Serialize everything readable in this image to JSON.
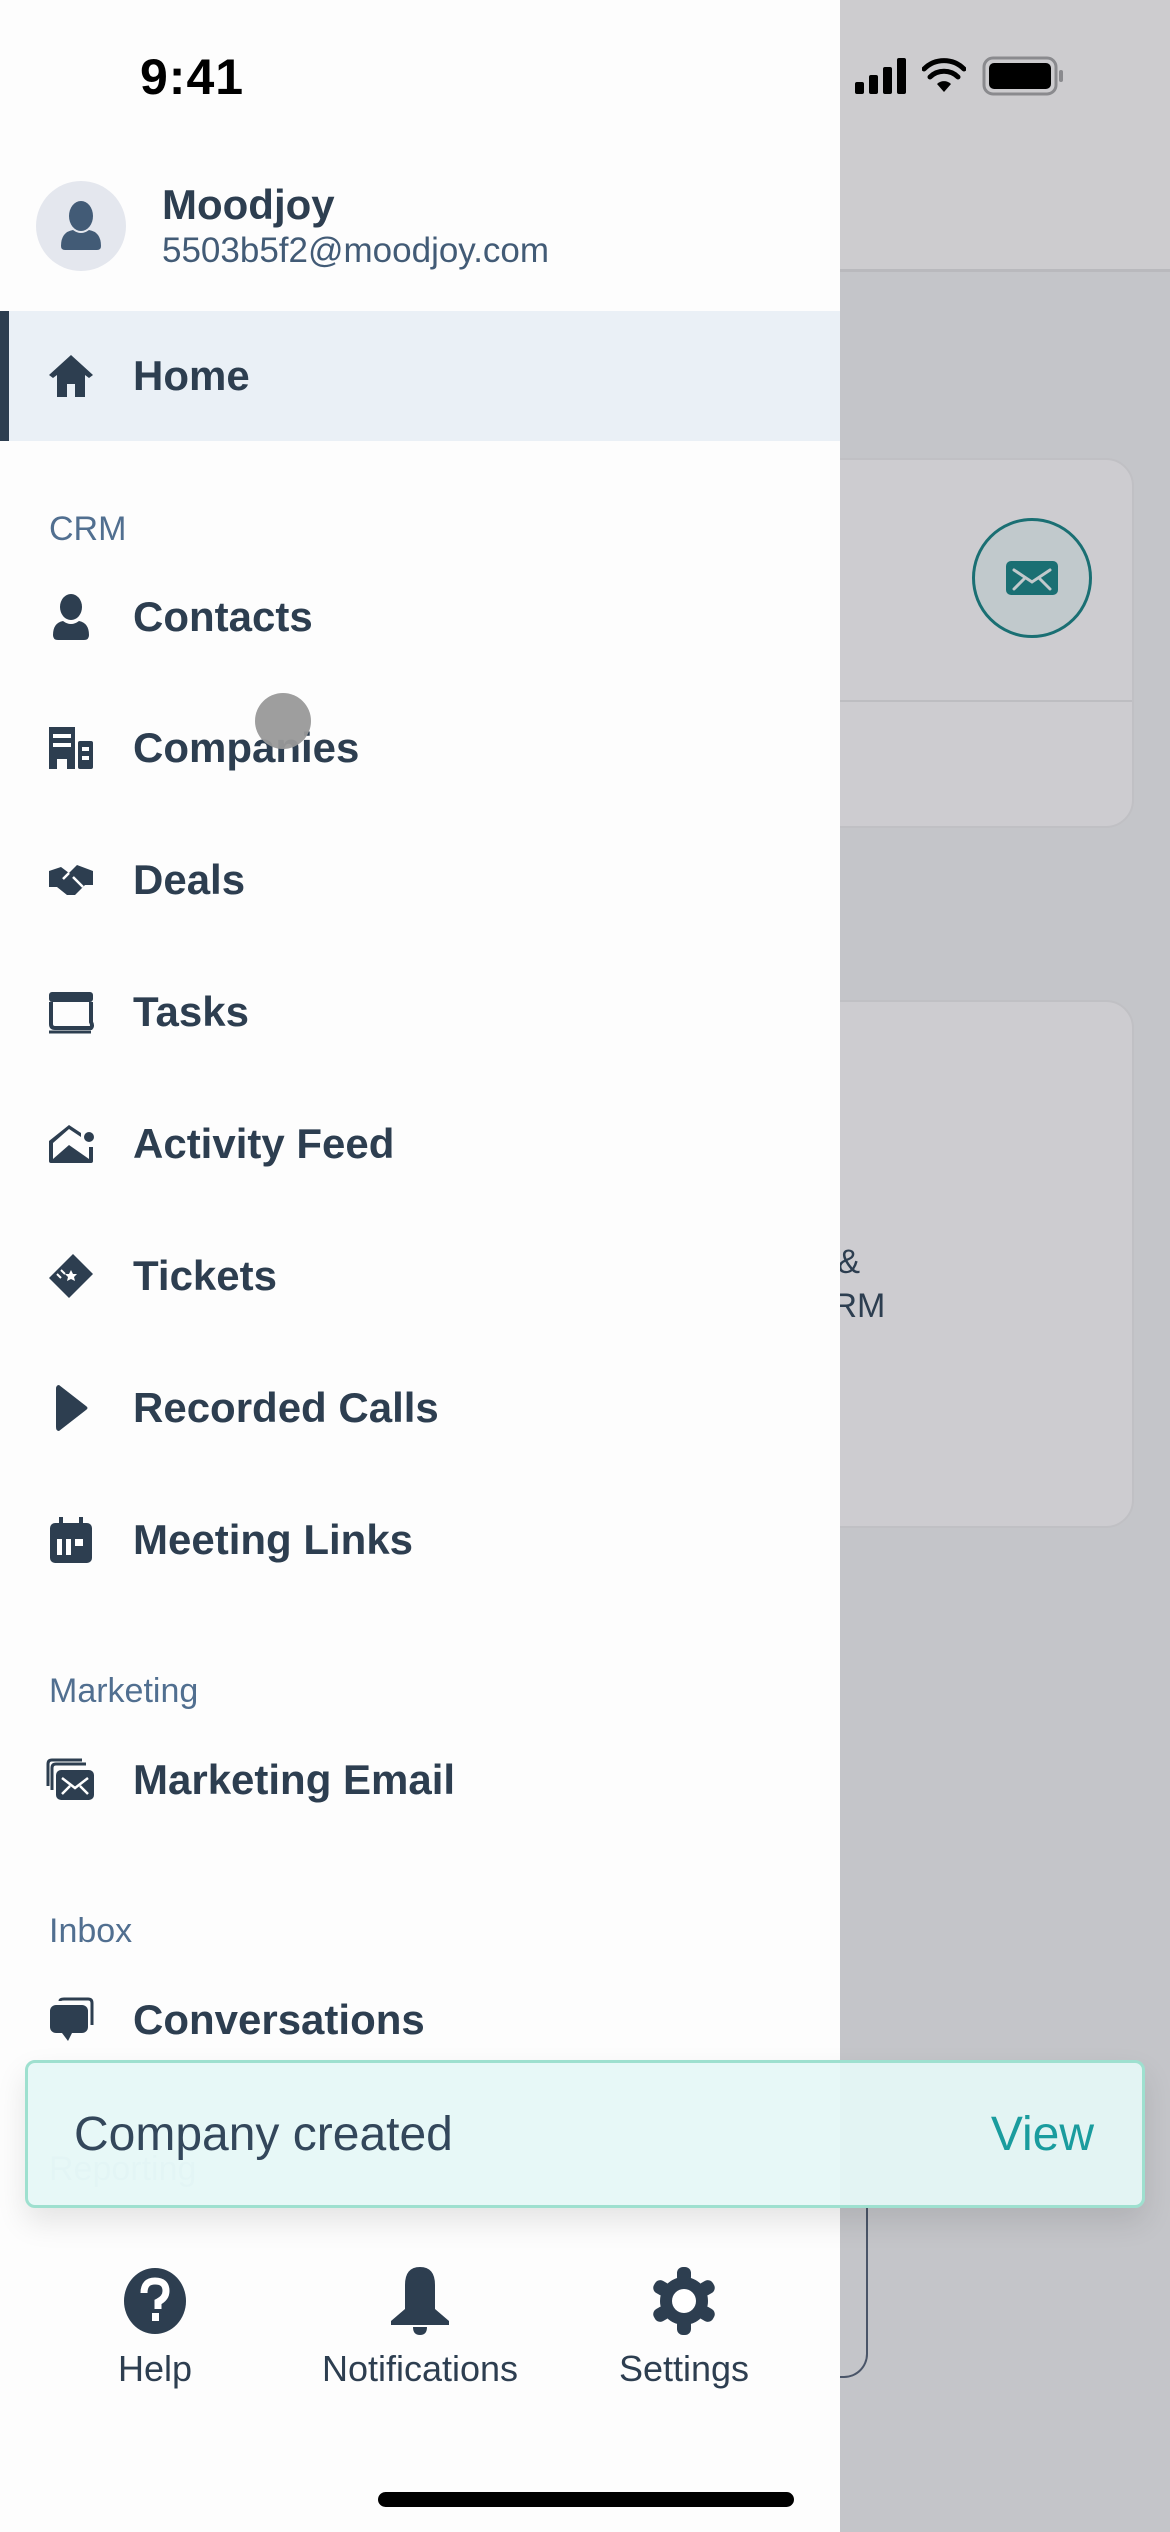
{
  "status_bar": {
    "time": "9:41"
  },
  "profile": {
    "name": "Moodjoy",
    "email": "5503b5f2@moodjoy.com",
    "avatar_icon": "user-silhouette-icon"
  },
  "drawer": {
    "home": {
      "label": "Home",
      "icon": "home-icon",
      "active": true
    },
    "sections": [
      {
        "title": "CRM",
        "items": [
          {
            "label": "Contacts",
            "icon": "contact-icon"
          },
          {
            "label": "Companies",
            "icon": "building-icon"
          },
          {
            "label": "Deals",
            "icon": "handshake-icon"
          },
          {
            "label": "Tasks",
            "icon": "tasks-icon"
          },
          {
            "label": "Activity Feed",
            "icon": "activity-feed-icon"
          },
          {
            "label": "Tickets",
            "icon": "ticket-icon"
          },
          {
            "label": "Recorded Calls",
            "icon": "play-icon"
          },
          {
            "label": "Meeting Links",
            "icon": "calendar-icon"
          }
        ]
      },
      {
        "title": "Marketing",
        "items": [
          {
            "label": "Marketing Email",
            "icon": "marketing-email-icon"
          }
        ]
      },
      {
        "title": "Inbox",
        "items": [
          {
            "label": "Conversations",
            "icon": "chat-bubble-icon"
          }
        ]
      },
      {
        "title": "Reporting",
        "items": []
      }
    ]
  },
  "toast": {
    "message": "Company created",
    "action": "View"
  },
  "bottom_bar": [
    {
      "label": "Help",
      "icon": "help-icon"
    },
    {
      "label": "Notifications",
      "icon": "bell-icon"
    },
    {
      "label": "Settings",
      "icon": "gear-icon"
    }
  ],
  "background": {
    "card_text": "gs &\n' CRM",
    "accent_color": "#1a6f73"
  },
  "colors": {
    "primary_text": "#2d3e50",
    "section_label": "#516f90",
    "active_bg": "#eaf0f6",
    "toast_bg": "#e5f8f6",
    "toast_border": "#9ee0cf",
    "toast_action": "#1a9c9e"
  }
}
